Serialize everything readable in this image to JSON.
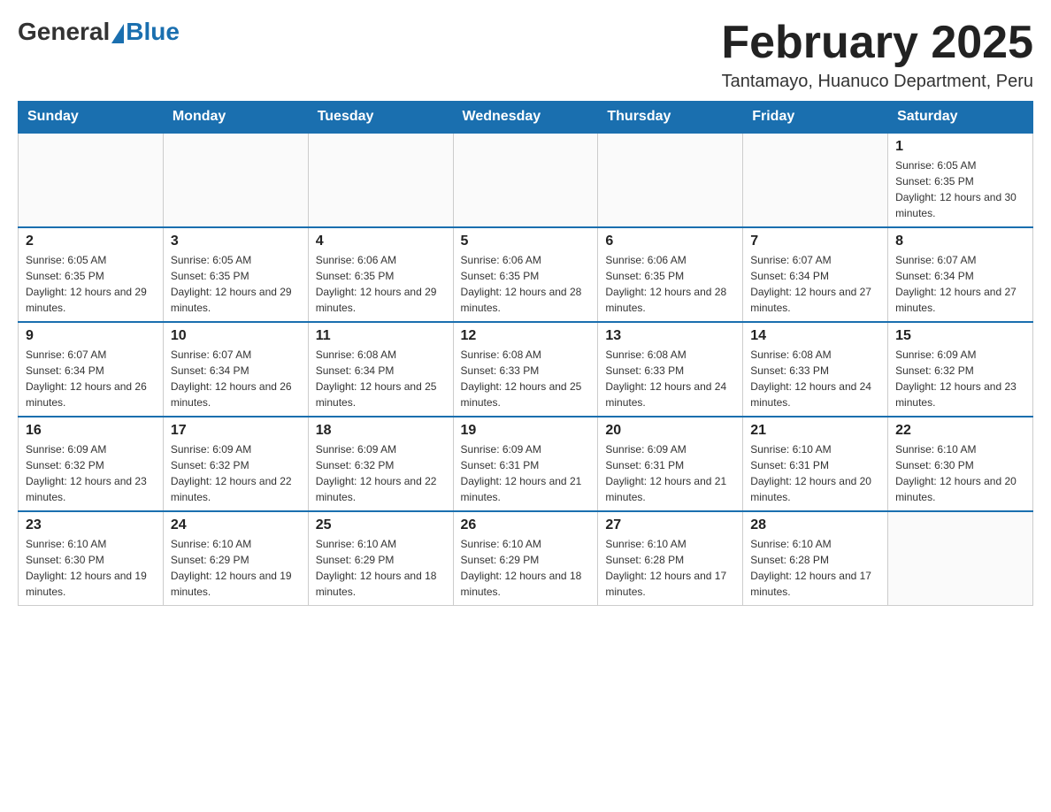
{
  "header": {
    "logo_general": "General",
    "logo_blue": "Blue",
    "month_title": "February 2025",
    "location": "Tantamayo, Huanuco Department, Peru"
  },
  "days_of_week": [
    "Sunday",
    "Monday",
    "Tuesday",
    "Wednesday",
    "Thursday",
    "Friday",
    "Saturday"
  ],
  "weeks": [
    [
      {
        "day": "",
        "info": ""
      },
      {
        "day": "",
        "info": ""
      },
      {
        "day": "",
        "info": ""
      },
      {
        "day": "",
        "info": ""
      },
      {
        "day": "",
        "info": ""
      },
      {
        "day": "",
        "info": ""
      },
      {
        "day": "1",
        "info": "Sunrise: 6:05 AM\nSunset: 6:35 PM\nDaylight: 12 hours and 30 minutes."
      }
    ],
    [
      {
        "day": "2",
        "info": "Sunrise: 6:05 AM\nSunset: 6:35 PM\nDaylight: 12 hours and 29 minutes."
      },
      {
        "day": "3",
        "info": "Sunrise: 6:05 AM\nSunset: 6:35 PM\nDaylight: 12 hours and 29 minutes."
      },
      {
        "day": "4",
        "info": "Sunrise: 6:06 AM\nSunset: 6:35 PM\nDaylight: 12 hours and 29 minutes."
      },
      {
        "day": "5",
        "info": "Sunrise: 6:06 AM\nSunset: 6:35 PM\nDaylight: 12 hours and 28 minutes."
      },
      {
        "day": "6",
        "info": "Sunrise: 6:06 AM\nSunset: 6:35 PM\nDaylight: 12 hours and 28 minutes."
      },
      {
        "day": "7",
        "info": "Sunrise: 6:07 AM\nSunset: 6:34 PM\nDaylight: 12 hours and 27 minutes."
      },
      {
        "day": "8",
        "info": "Sunrise: 6:07 AM\nSunset: 6:34 PM\nDaylight: 12 hours and 27 minutes."
      }
    ],
    [
      {
        "day": "9",
        "info": "Sunrise: 6:07 AM\nSunset: 6:34 PM\nDaylight: 12 hours and 26 minutes."
      },
      {
        "day": "10",
        "info": "Sunrise: 6:07 AM\nSunset: 6:34 PM\nDaylight: 12 hours and 26 minutes."
      },
      {
        "day": "11",
        "info": "Sunrise: 6:08 AM\nSunset: 6:34 PM\nDaylight: 12 hours and 25 minutes."
      },
      {
        "day": "12",
        "info": "Sunrise: 6:08 AM\nSunset: 6:33 PM\nDaylight: 12 hours and 25 minutes."
      },
      {
        "day": "13",
        "info": "Sunrise: 6:08 AM\nSunset: 6:33 PM\nDaylight: 12 hours and 24 minutes."
      },
      {
        "day": "14",
        "info": "Sunrise: 6:08 AM\nSunset: 6:33 PM\nDaylight: 12 hours and 24 minutes."
      },
      {
        "day": "15",
        "info": "Sunrise: 6:09 AM\nSunset: 6:32 PM\nDaylight: 12 hours and 23 minutes."
      }
    ],
    [
      {
        "day": "16",
        "info": "Sunrise: 6:09 AM\nSunset: 6:32 PM\nDaylight: 12 hours and 23 minutes."
      },
      {
        "day": "17",
        "info": "Sunrise: 6:09 AM\nSunset: 6:32 PM\nDaylight: 12 hours and 22 minutes."
      },
      {
        "day": "18",
        "info": "Sunrise: 6:09 AM\nSunset: 6:32 PM\nDaylight: 12 hours and 22 minutes."
      },
      {
        "day": "19",
        "info": "Sunrise: 6:09 AM\nSunset: 6:31 PM\nDaylight: 12 hours and 21 minutes."
      },
      {
        "day": "20",
        "info": "Sunrise: 6:09 AM\nSunset: 6:31 PM\nDaylight: 12 hours and 21 minutes."
      },
      {
        "day": "21",
        "info": "Sunrise: 6:10 AM\nSunset: 6:31 PM\nDaylight: 12 hours and 20 minutes."
      },
      {
        "day": "22",
        "info": "Sunrise: 6:10 AM\nSunset: 6:30 PM\nDaylight: 12 hours and 20 minutes."
      }
    ],
    [
      {
        "day": "23",
        "info": "Sunrise: 6:10 AM\nSunset: 6:30 PM\nDaylight: 12 hours and 19 minutes."
      },
      {
        "day": "24",
        "info": "Sunrise: 6:10 AM\nSunset: 6:29 PM\nDaylight: 12 hours and 19 minutes."
      },
      {
        "day": "25",
        "info": "Sunrise: 6:10 AM\nSunset: 6:29 PM\nDaylight: 12 hours and 18 minutes."
      },
      {
        "day": "26",
        "info": "Sunrise: 6:10 AM\nSunset: 6:29 PM\nDaylight: 12 hours and 18 minutes."
      },
      {
        "day": "27",
        "info": "Sunrise: 6:10 AM\nSunset: 6:28 PM\nDaylight: 12 hours and 17 minutes."
      },
      {
        "day": "28",
        "info": "Sunrise: 6:10 AM\nSunset: 6:28 PM\nDaylight: 12 hours and 17 minutes."
      },
      {
        "day": "",
        "info": ""
      }
    ]
  ]
}
